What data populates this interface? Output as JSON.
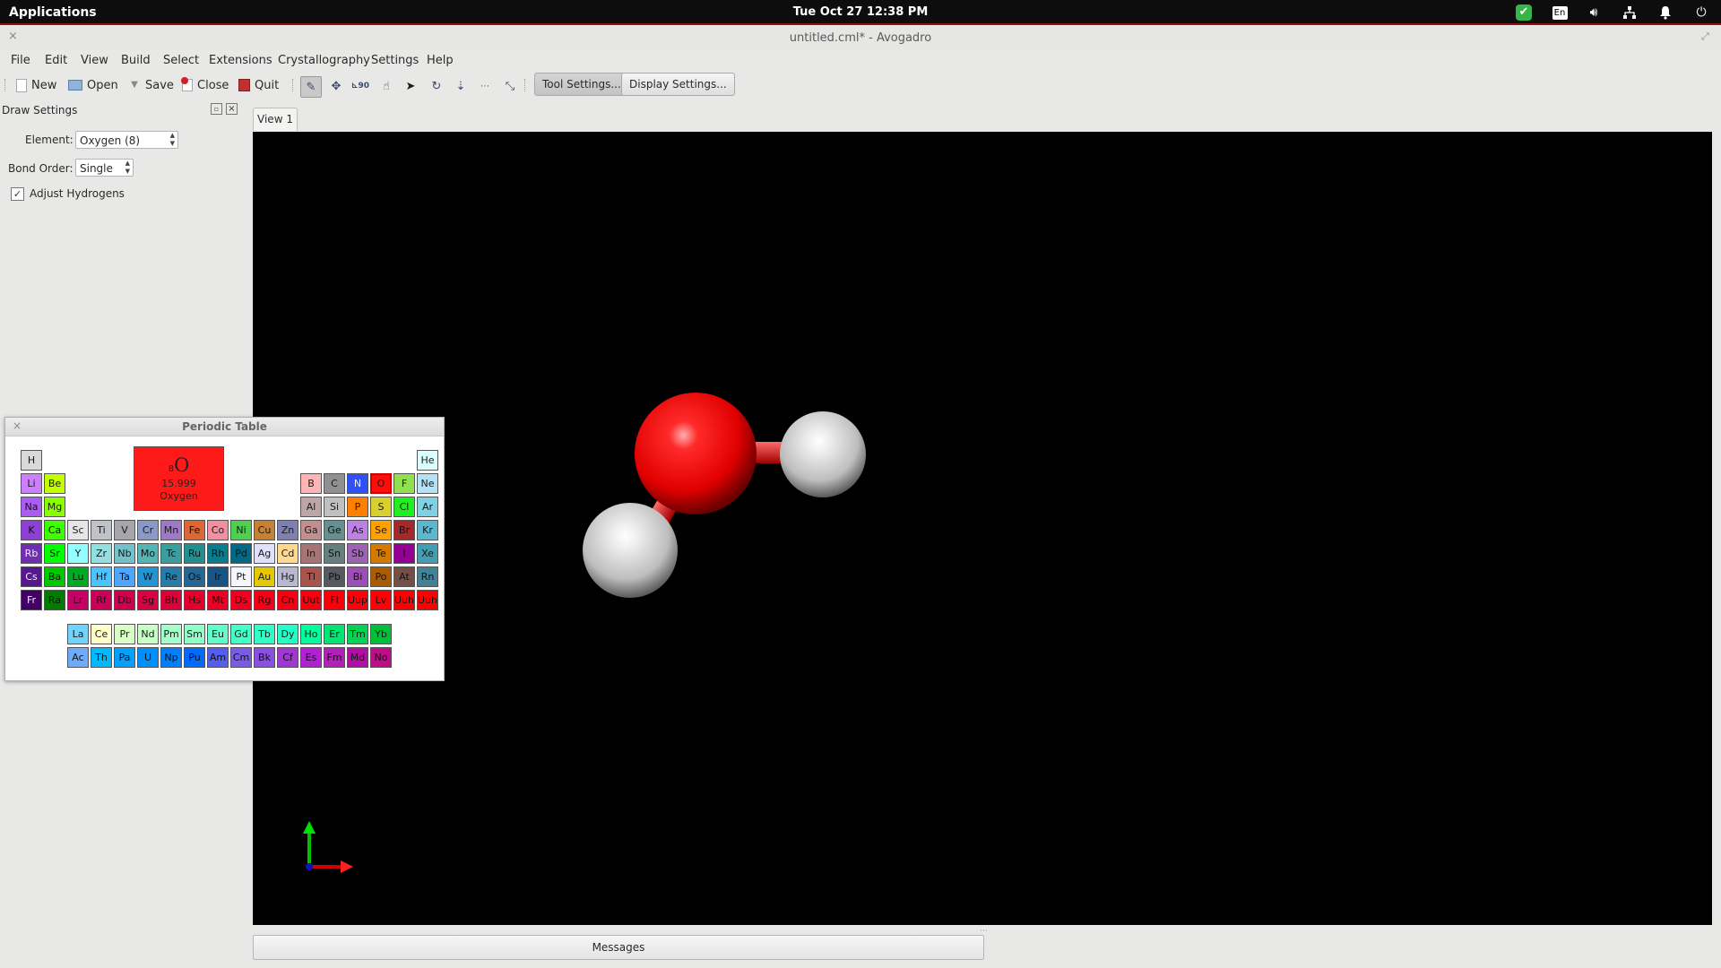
{
  "topbar": {
    "applications": "Applications",
    "datetime": "Tue Oct 27    12:38 PM",
    "keyboard_layout": "En"
  },
  "window": {
    "title": "untitled.cml* - Avogadro"
  },
  "menubar": {
    "items": [
      "File",
      "Edit",
      "View",
      "Build",
      "Select",
      "Extensions",
      "Crystallography",
      "Settings",
      "Help"
    ]
  },
  "toolbar": {
    "new_label": "New",
    "open_label": "Open",
    "save_label": "Save",
    "close_label": "Close",
    "quit_label": "Quit",
    "tool_settings_label": "Tool Settings...",
    "display_settings_label": "Display Settings..."
  },
  "draw_settings": {
    "title": "Draw Settings",
    "element_label": "Element:",
    "element_value": "Oxygen (8)",
    "bond_order_label": "Bond Order:",
    "bond_order_value": "Single",
    "adjust_hydrogens_label": "Adjust Hydrogens",
    "adjust_hydrogens_checked": true
  },
  "view": {
    "tab_label": "View 1",
    "messages_label": "Messages"
  },
  "periodic_table": {
    "title": "Periodic Table",
    "selected": {
      "atomic_number": "8",
      "symbol": "O",
      "mass": "15.999",
      "name": "Oxygen"
    },
    "main_rows": [
      [
        "H",
        "",
        "",
        "",
        "",
        "",
        "",
        "",
        "",
        "",
        "",
        "",
        "",
        "",
        "",
        "",
        "",
        "He"
      ],
      [
        "Li",
        "Be",
        "",
        "",
        "",
        "",
        "",
        "",
        "",
        "",
        "",
        "",
        "B",
        "C",
        "N",
        "O",
        "F",
        "Ne"
      ],
      [
        "Na",
        "Mg",
        "",
        "",
        "",
        "",
        "",
        "",
        "",
        "",
        "",
        "",
        "Al",
        "Si",
        "P",
        "S",
        "Cl",
        "Ar"
      ],
      [
        "K",
        "Ca",
        "Sc",
        "Ti",
        "V",
        "Cr",
        "Mn",
        "Fe",
        "Co",
        "Ni",
        "Cu",
        "Zn",
        "Ga",
        "Ge",
        "As",
        "Se",
        "Br",
        "Kr"
      ],
      [
        "Rb",
        "Sr",
        "Y",
        "Zr",
        "Nb",
        "Mo",
        "Tc",
        "Ru",
        "Rh",
        "Pd",
        "Ag",
        "Cd",
        "In",
        "Sn",
        "Sb",
        "Te",
        "I",
        "Xe"
      ],
      [
        "Cs",
        "Ba",
        "Lu",
        "Hf",
        "Ta",
        "W",
        "Re",
        "Os",
        "Ir",
        "Pt",
        "Au",
        "Hg",
        "Tl",
        "Pb",
        "Bi",
        "Po",
        "At",
        "Rn"
      ],
      [
        "Fr",
        "Ra",
        "Lr",
        "Rf",
        "Db",
        "Sg",
        "Bh",
        "Hs",
        "Mt",
        "Ds",
        "Rg",
        "Cn",
        "Uut",
        "Fl",
        "Uup",
        "Lv",
        "Uuh",
        "Uuh"
      ]
    ],
    "f_rows": [
      [
        "La",
        "Ce",
        "Pr",
        "Nd",
        "Pm",
        "Sm",
        "Eu",
        "Gd",
        "Tb",
        "Dy",
        "Ho",
        "Er",
        "Tm",
        "Yb"
      ],
      [
        "Ac",
        "Th",
        "Pa",
        "U",
        "Np",
        "Pu",
        "Am",
        "Cm",
        "Bk",
        "Cf",
        "Es",
        "Fm",
        "Md",
        "No"
      ]
    ],
    "colors": {
      "H": "#d9d9d9",
      "He": "#d9ffff",
      "Li": "#cc80ff",
      "Be": "#c2ff00",
      "B": "#ffb5b5",
      "C": "#909090",
      "N": "#3050f8",
      "O": "#ff0d0d",
      "F": "#90e050",
      "Ne": "#b3e3f5",
      "Na": "#ab5cf2",
      "Mg": "#8aff00",
      "Al": "#bfa6a6",
      "Si": "#c0c0c0",
      "P": "#ff8000",
      "S": "#d8d030",
      "Cl": "#1ff01f",
      "Ar": "#80d1e3",
      "K": "#8f40d4",
      "Ca": "#3dff00",
      "Sc": "#e6e6e6",
      "Ti": "#bfc2c7",
      "V": "#a6a6ab",
      "Cr": "#8a99c7",
      "Mn": "#9c7ac7",
      "Fe": "#e06633",
      "Co": "#f090a0",
      "Ni": "#50d050",
      "Cu": "#c88033",
      "Zn": "#7d80b0",
      "Ga": "#c28f8f",
      "Ge": "#668f8f",
      "As": "#bd80e3",
      "Se": "#ffa100",
      "Br": "#a62929",
      "Kr": "#5cb8d1",
      "Rb": "#702eb0",
      "Sr": "#00ff00",
      "Y": "#94ffff",
      "Zr": "#94e0e0",
      "Nb": "#73c2c9",
      "Mo": "#54b5b5",
      "Tc": "#3b9e9e",
      "Ru": "#248f8f",
      "Rh": "#0a7d8c",
      "Pd": "#006985",
      "Ag": "#e0e0ff",
      "Cd": "#ffd98f",
      "In": "#a67573",
      "Sn": "#668080",
      "Sb": "#9e63b5",
      "Te": "#d47a00",
      "I": "#940094",
      "Xe": "#429eb0",
      "Cs": "#57178f",
      "Ba": "#00c900",
      "Lu": "#00ab24",
      "Hf": "#4dc2ff",
      "Ta": "#4da6ff",
      "W": "#2194d6",
      "Re": "#267dab",
      "Os": "#266696",
      "Ir": "#175487",
      "Pt": "#f5f5ff",
      "Au": "#e6c800",
      "Hg": "#b8b8d0",
      "Tl": "#a6544d",
      "Pb": "#575961",
      "Bi": "#9e4fb5",
      "Po": "#ab5c00",
      "At": "#754f45",
      "Rn": "#428296",
      "Fr": "#420066",
      "Ra": "#007d00",
      "Lr": "#c70066",
      "Rf": "#cc0059",
      "Db": "#d1004f",
      "Sg": "#d90045",
      "Bh": "#e00038",
      "Hs": "#e6002e",
      "Mt": "#eb0026",
      "Ds": "#f00020",
      "Rg": "#f50018",
      "Cn": "#f80012",
      "Uut": "#fa000e",
      "Fl": "#fc000a",
      "Uup": "#fd0008",
      "Lv": "#fe0005",
      "Uuh": "#ff0002",
      "La": "#70d4ff",
      "Ce": "#ffffc7",
      "Pr": "#d9ffc7",
      "Nd": "#c7ffc7",
      "Pm": "#a3ffc7",
      "Sm": "#8fffc7",
      "Eu": "#61ffc7",
      "Gd": "#45ffc7",
      "Tb": "#30ffc7",
      "Dy": "#1fffc7",
      "Ho": "#00ff9c",
      "Er": "#00e675",
      "Tm": "#00d452",
      "Yb": "#00bf38",
      "Ac": "#70abfa",
      "Th": "#00baff",
      "Pa": "#00a1ff",
      "U": "#008fff",
      "Np": "#0080ff",
      "Pu": "#006bff",
      "Am": "#545cf2",
      "Cm": "#785ce3",
      "Bk": "#8a4fe3",
      "Cf": "#a136d4",
      "Es": "#b31fd4",
      "Fm": "#b31fba",
      "Md": "#b30da6",
      "No": "#bd0d87"
    }
  },
  "molecule": {
    "atoms": [
      "O",
      "H",
      "H"
    ],
    "colors": {
      "oxygen": "#ff0000",
      "hydrogen": "#e8e8e8"
    }
  }
}
